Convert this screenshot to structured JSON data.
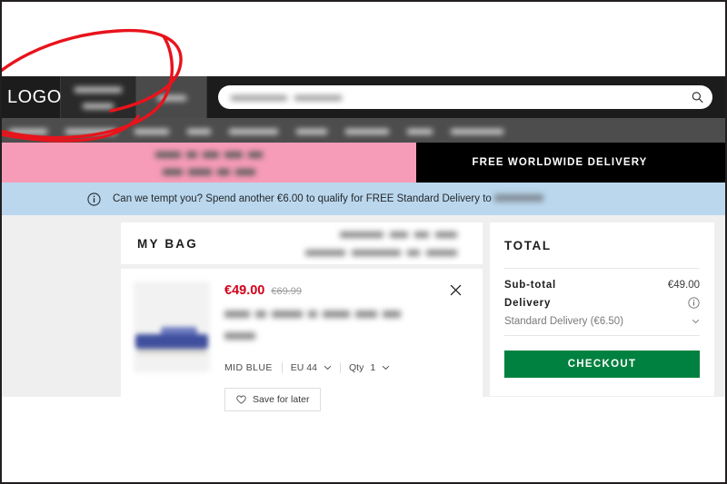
{
  "header": {
    "logo": "LOGO",
    "nav_tabs": [
      {
        "name": "nav-tab-1",
        "redacted": true
      },
      {
        "name": "nav-tab-2",
        "redacted": true
      }
    ],
    "search": {
      "placeholder_redacted": true,
      "icon": "search-icon"
    }
  },
  "subnav": {
    "items": [
      {
        "name": "subnav-item-1",
        "redacted": true
      },
      {
        "name": "subnav-item-2",
        "redacted": true
      },
      {
        "name": "subnav-item-3",
        "redacted": true
      },
      {
        "name": "subnav-item-4",
        "redacted": true
      },
      {
        "name": "subnav-item-5",
        "redacted": true
      },
      {
        "name": "subnav-item-6",
        "redacted": true
      },
      {
        "name": "subnav-item-7",
        "redacted": true
      },
      {
        "name": "subnav-item-8",
        "redacted": true
      }
    ]
  },
  "promo": {
    "pink_redacted": true,
    "pink_color": "#F79CB8",
    "black_text": "FREE WORLDWIDE DELIVERY",
    "black_color": "#000000"
  },
  "info_strip": {
    "icon": "info-circle-icon",
    "text_before": "Can we tempt you? Spend another €6.00 to qualify for FREE Standard Delivery to",
    "destination_redacted": true,
    "background": "#BBD7ED"
  },
  "bag": {
    "title": "MY BAG",
    "header_note_redacted": true,
    "item": {
      "image_redacted": true,
      "price_now": "€49.00",
      "price_now_color": "#d0021b",
      "price_was": "€69.99",
      "name_redacted": true,
      "color": "MID BLUE",
      "size": "EU 44",
      "qty_label": "Qty",
      "qty_value": "1",
      "save_label": "Save for later",
      "save_icon": "heart-icon",
      "remove_icon": "close-icon"
    }
  },
  "total": {
    "title": "TOTAL",
    "subtotal_label": "Sub-total",
    "subtotal_value": "€49.00",
    "delivery_label": "Delivery",
    "delivery_info_icon": "info-circle-icon",
    "shipping_option": "Standard Delivery (€6.50)",
    "shipping_chevron": "chevron-down-icon",
    "checkout_label": "CHECKOUT",
    "checkout_color": "#00813F"
  },
  "annotation": {
    "shape": "hand-drawn-red-ellipse",
    "color": "#e8131b"
  }
}
